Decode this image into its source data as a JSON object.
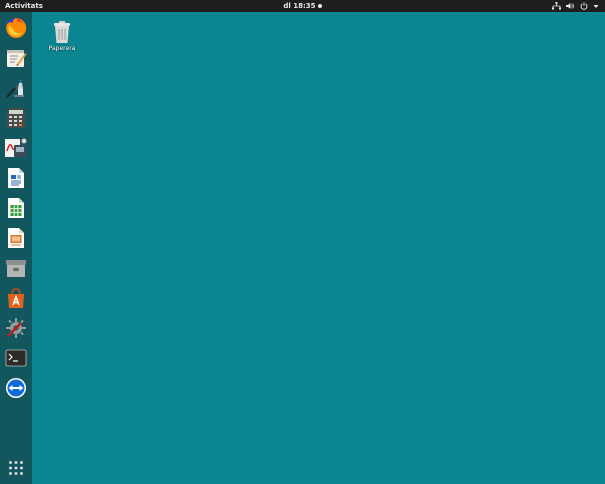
{
  "topbar": {
    "activities_label": "Activitats",
    "clock": "dl 18:35"
  },
  "desktop": {
    "trash_label": "Paperera"
  },
  "dock": {
    "items": [
      {
        "icon": "firefox-icon"
      },
      {
        "icon": "text-editor-icon"
      },
      {
        "icon": "paint-brush-icon"
      },
      {
        "icon": "calculator-icon"
      },
      {
        "icon": "pdf-tool-icon"
      },
      {
        "icon": "writer-document-icon"
      },
      {
        "icon": "calc-spreadsheet-icon"
      },
      {
        "icon": "impress-presentation-icon"
      },
      {
        "icon": "archive-manager-icon"
      },
      {
        "icon": "software-center-icon"
      },
      {
        "icon": "settings-tools-icon"
      },
      {
        "icon": "terminal-icon"
      },
      {
        "icon": "teamviewer-icon"
      },
      {
        "icon": "app-grid-icon"
      }
    ]
  },
  "colors": {
    "desktop_bg": "#0b8690",
    "dock_bg": "#12575d",
    "topbar_bg": "#1e1e1e"
  }
}
